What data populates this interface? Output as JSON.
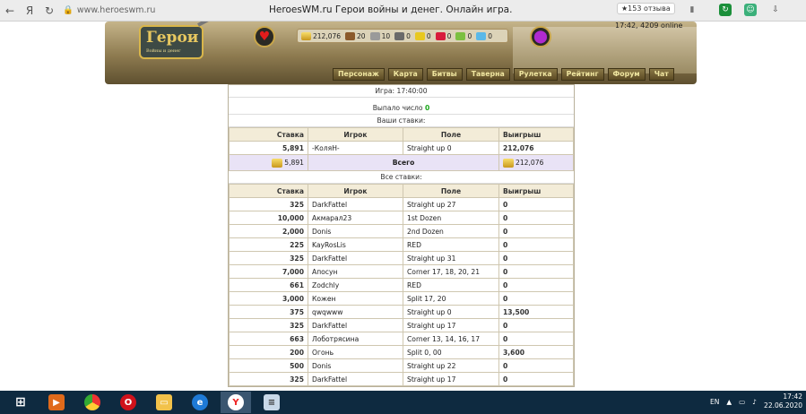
{
  "browser": {
    "address": "www.heroeswm.ru",
    "title": "HeroesWM.ru Герои войны и денег. Онлайн игра.",
    "reviews": "★153 отзыва"
  },
  "header": {
    "logo": "Герои",
    "logo_sub": "Войны и денег",
    "resources": [
      "212,076",
      "20",
      "10",
      "0",
      "0",
      "0",
      "0",
      "0"
    ],
    "clock": "17:42, 4209 online"
  },
  "nav": [
    "Персонаж",
    "Карта",
    "Битвы",
    "Таверна",
    "Рулетка",
    "Рейтинг",
    "Форум",
    "Чат"
  ],
  "game": {
    "time": "Игра: 17:40:00",
    "result_label": "Выпало число",
    "result": "0",
    "your_bets": "Ваши ставки:",
    "all_bets": "Все ставки:",
    "total_label": "Всего",
    "total_bet": "5,891",
    "total_win": "212,076"
  },
  "columns": {
    "bet": "Ставка",
    "player": "Игрок",
    "field": "Поле",
    "win": "Выигрыш"
  },
  "your_rows": [
    {
      "bet": "5,891",
      "player": "-КоляН-",
      "field": "Straight up 0",
      "win": "212,076"
    }
  ],
  "all_rows": [
    {
      "bet": "325",
      "player": "DarkFattel",
      "field": "Straight up 27",
      "win": "0"
    },
    {
      "bet": "10,000",
      "player": "Акмарал23",
      "field": "1st Dozen",
      "win": "0"
    },
    {
      "bet": "2,000",
      "player": "Donis",
      "field": "2nd Dozen",
      "win": "0"
    },
    {
      "bet": "225",
      "player": "KayRosLis",
      "field": "RED",
      "win": "0"
    },
    {
      "bet": "325",
      "player": "DarkFattel",
      "field": "Straight up 31",
      "win": "0"
    },
    {
      "bet": "7,000",
      "player": "Апосун",
      "field": "Corner 17, 18, 20, 21",
      "win": "0"
    },
    {
      "bet": "661",
      "player": "Zodchly",
      "field": "RED",
      "win": "0"
    },
    {
      "bet": "3,000",
      "player": "Кожен",
      "field": "Split 17, 20",
      "win": "0"
    },
    {
      "bet": "375",
      "player": "qwqwww",
      "field": "Straight up 0",
      "win": "13,500"
    },
    {
      "bet": "325",
      "player": "DarkFattel",
      "field": "Straight up 17",
      "win": "0"
    },
    {
      "bet": "663",
      "player": "Лоботрясина",
      "field": "Corner 13, 14, 16, 17",
      "win": "0"
    },
    {
      "bet": "200",
      "player": "Огонь",
      "field": "Split 0, 00",
      "win": "3,600"
    },
    {
      "bet": "500",
      "player": "Donis",
      "field": "Straight up 22",
      "win": "0"
    },
    {
      "bet": "325",
      "player": "DarkFattel",
      "field": "Straight up 17",
      "win": "0"
    }
  ],
  "taskbar": {
    "lang": "EN",
    "time": "17:42",
    "date": "22.06.2020"
  }
}
